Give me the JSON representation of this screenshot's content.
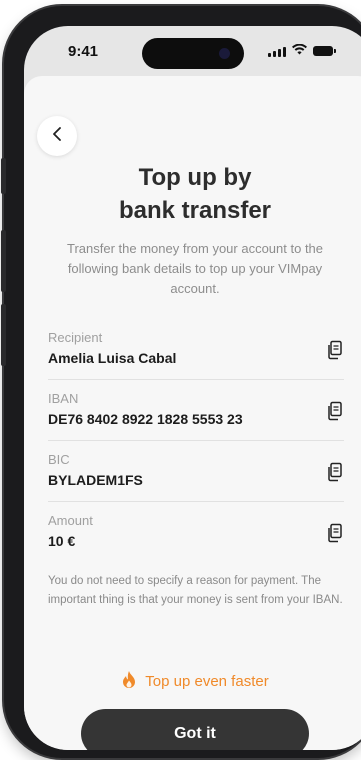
{
  "status_bar": {
    "time": "9:41"
  },
  "header": {
    "title": "Top up by\nbank transfer"
  },
  "intro": {
    "text": "Transfer the money from your account to the following bank details to top up your VIMpay account."
  },
  "fields": [
    {
      "label": "Recipient",
      "value": "Amelia Luisa Cabal"
    },
    {
      "label": "IBAN",
      "value": "DE76 8402 8922 1828 5553 23"
    },
    {
      "label": "BIC",
      "value": "BYLADEM1FS"
    },
    {
      "label": "Amount",
      "value": "10 €"
    }
  ],
  "note": {
    "text": "You do not need to specify a reason for payment. The important thing is that your money is sent from your IBAN."
  },
  "faster_link": {
    "label": "Top up even faster",
    "icon": "flame-icon"
  },
  "primary_button": {
    "label": "Got it"
  },
  "colors": {
    "accent": "#f08a2a",
    "button": "#353535",
    "background": "#f7f7f7",
    "text": "#1c1c1c"
  }
}
